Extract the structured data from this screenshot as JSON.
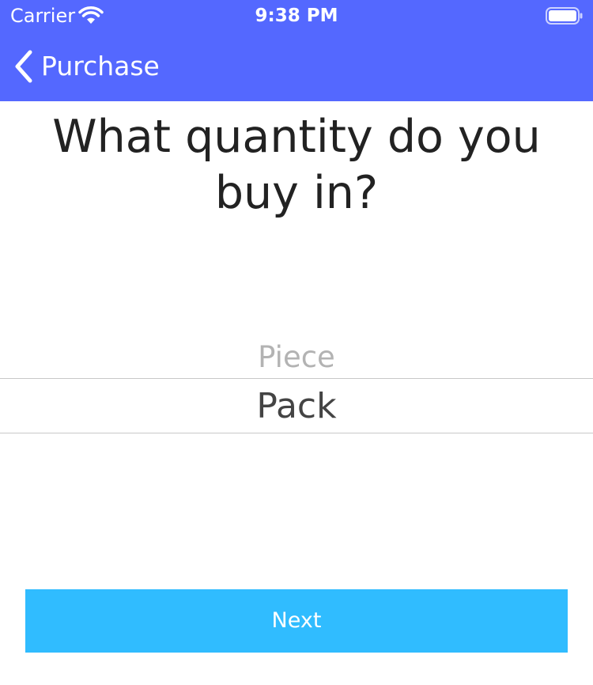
{
  "status_bar": {
    "carrier": "Carrier",
    "time": "9:38 PM",
    "wifi_icon": "wifi-icon",
    "battery_icon": "battery-icon"
  },
  "nav": {
    "back_icon": "chevron-left-icon",
    "back_label": "Purchase",
    "background_color": "#5468ff"
  },
  "question": "What quantity do you buy in?",
  "picker": {
    "options": [
      "Piece",
      "Pack"
    ],
    "selected": "Pack"
  },
  "next_button": {
    "label": "Next",
    "color": "#30bcff"
  }
}
